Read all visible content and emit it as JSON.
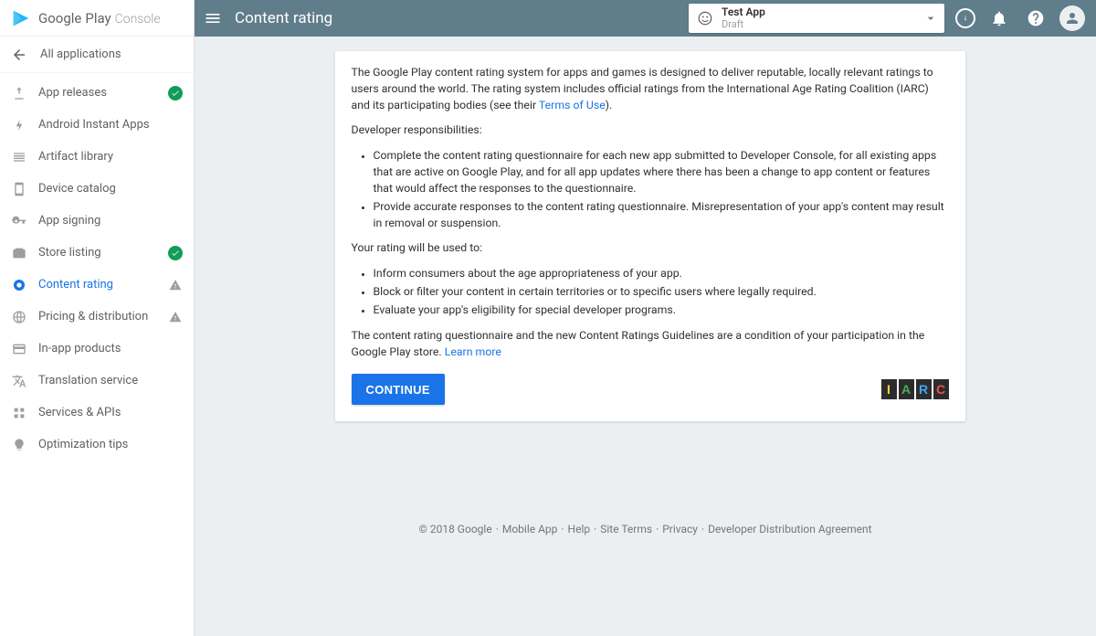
{
  "brand": {
    "google": "Google",
    "play": "Play",
    "console": "Console"
  },
  "nav": {
    "all_apps": "All applications",
    "items": [
      {
        "label": "App releases",
        "status": "check"
      },
      {
        "label": "Android Instant Apps",
        "status": ""
      },
      {
        "label": "Artifact library",
        "status": ""
      },
      {
        "label": "Device catalog",
        "status": ""
      },
      {
        "label": "App signing",
        "status": ""
      },
      {
        "label": "Store listing",
        "status": "check"
      },
      {
        "label": "Content rating",
        "status": "warn",
        "active": true
      },
      {
        "label": "Pricing & distribution",
        "status": "warn"
      },
      {
        "label": "In-app products",
        "status": ""
      },
      {
        "label": "Translation service",
        "status": ""
      },
      {
        "label": "Services & APIs",
        "status": ""
      },
      {
        "label": "Optimization tips",
        "status": ""
      }
    ]
  },
  "header": {
    "title": "Content rating",
    "app_name": "Test App",
    "app_status": "Draft"
  },
  "content": {
    "intro_a": "The Google Play content rating system for apps and games is designed to deliver reputable, locally relevant ratings to users around the world. The rating system includes official ratings from the International Age Rating Coalition (IARC) and its participating bodies (see their ",
    "intro_link": "Terms of Use",
    "intro_b": ").",
    "resp_title": "Developer responsibilities:",
    "resp_items": [
      "Complete the content rating questionnaire for each new app submitted to Developer Console, for all existing apps that are active on Google Play, and for all app updates where there has been a change to app content or features that would affect the responses to the questionnaire.",
      "Provide accurate responses to the content rating questionnaire. Misrepresentation of your app's content may result in removal or suspension."
    ],
    "use_title": "Your rating will be used to:",
    "use_items": [
      "Inform consumers about the age appropriateness of your app.",
      "Block or filter your content in certain territories or to specific users where legally required.",
      "Evaluate your app's eligibility for special developer programs."
    ],
    "outro_a": "The content rating questionnaire and the new Content Ratings Guidelines are a condition of your participation in the Google Play store. ",
    "outro_link": "Learn more",
    "continue": "CONTINUE",
    "iarc": {
      "i": "I",
      "a": "A",
      "r": "R",
      "c": "C"
    }
  },
  "footer": {
    "copyright": "© 2018 Google",
    "links": [
      "Mobile App",
      "Help",
      "Site Terms",
      "Privacy",
      "Developer Distribution Agreement"
    ]
  }
}
